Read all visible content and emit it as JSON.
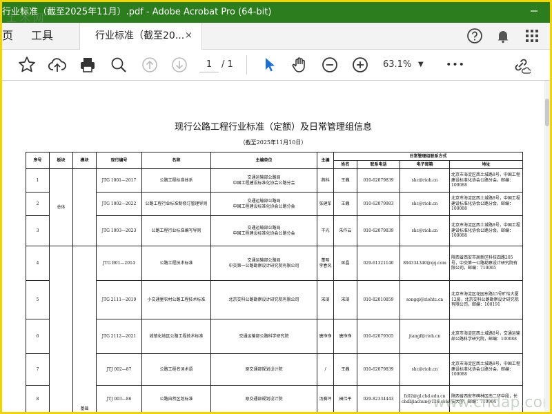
{
  "window": {
    "title": "行业标准（截至2025年11月）.pdf - Adobe Acrobat Pro (64-bit)",
    "minimize_icon": "minimize-icon",
    "colors": {
      "titlebar": "#2b7d1e",
      "frame": "#f0d400"
    }
  },
  "tabs": {
    "home_label": "页",
    "tools_label": "工具",
    "doc_label": "行业标准（截至20...",
    "close_label": "×"
  },
  "toolbar": {
    "icons": [
      "star-icon",
      "upload-icon",
      "print-icon",
      "search-zoom-icon",
      "page-up-icon",
      "page-down-icon",
      "select-arrow-icon",
      "hand-icon",
      "zoom-out-icon",
      "zoom-in-icon",
      "more-icon",
      "link-cloud-icon"
    ],
    "page_current": "1",
    "page_total": "/ 1",
    "zoom": "63.1%",
    "more": "•••"
  },
  "document": {
    "title": "现行公路工程行业标准（定额）及日常管理组信息",
    "subtitle": "（截至2025年11月10日）",
    "headers": {
      "no": "序号",
      "section": "板块",
      "module": "模块",
      "code": "现行编号",
      "name": "名称",
      "editor": "主编单位",
      "chief": "主编",
      "contact_group": "日常管理组联系方式",
      "person": "姓名",
      "phone": "联系电话",
      "email": "电子邮箱",
      "address": "地址"
    },
    "section_general": "总体",
    "module_basic": "基础",
    "rows": [
      {
        "no": "1",
        "code": "JTG 1001—2017",
        "name": "公路工程标准体系",
        "editor": "交通运输部公路局\n中国工程建设标准化协会公路分会",
        "chief": "燕科",
        "person": "王巍",
        "phone": "010-62079839",
        "email": "shc@rioh.cn",
        "address": "北京市海淀区西土城路8号，中国工程建设标准化协会公路分会，邮编：100088"
      },
      {
        "no": "2",
        "code": "JTG 1002—2022",
        "name": "公路工程行业标准制修订管理导则",
        "editor": "交通运输部公路局\n中国工程建设标准化协会公路分会",
        "chief": "张建军",
        "person": "王巍",
        "phone": "010-62079983",
        "email": "shc@rioh.cn",
        "address": "北京市海淀区西土城路8号，中国工程建设标准化协会公路分会，邮编：100088"
      },
      {
        "no": "3",
        "code": "JTG 1003—2023",
        "name": "公路工程行业标准编写导则",
        "editor": "交通运输部公路局\n中国工程建设标准化协会公路分会",
        "chief": "干光",
        "person": "朱作云",
        "phone": "010-62079839",
        "email": "shc@rioh.cn",
        "address": "北京市海淀区西土城路8号，中国工程建设标准化协会公路分会，邮编：100088"
      },
      {
        "no": "4",
        "code": "JTG B01—2014",
        "name": "公路工程技术标准",
        "editor": "交通运输部公路局\n中交第一公路勘察设计研究院有限公司",
        "chief": "董明\n李春风",
        "person": "匡晶",
        "phone": "029-61321140",
        "email": "894334340@qq.com",
        "address": "陕西省西安市高新区科技四路205号，中交第一公路勘察设计研究院有限公司，邮编：710065"
      },
      {
        "no": "5",
        "code": "JTG 2111—2019",
        "name": "小交通量农村公路工程技术标准",
        "editor": "北京交科公路勘察设计研究院有限公司",
        "chief": "宋琦",
        "person": "宋琦",
        "phone": "010-82010859",
        "email": "songqi@riohtc.cn",
        "address": "北京市海淀区花园东路15号旷怡大厦12层，北京交科公路勘察设计研究院有限公司，邮编：100191"
      },
      {
        "no": "6",
        "code": "JTG 2112—2021",
        "name": "城镇化地区公路工程技术标准",
        "editor": "交通运输部公路科学研究院",
        "chief": "唐琤琤",
        "person": "唐琤琤",
        "phone": "010-62079505",
        "email": "jtangf@rioh.cn",
        "address": "北京市海淀区西土城路8号，交通运输部公路科学研究院，邮编：100088"
      },
      {
        "no": "7",
        "code": "JTJ 002—87",
        "name": "公路工程名词术语",
        "editor": "原交通部规划设计院",
        "chief": "/",
        "person": "王巍",
        "phone": "010-62079839",
        "email": "shc@rioh.cn",
        "address": "北京市海淀区西土城路8号，中国工程建设标准化协会公路分会，邮编：100088"
      },
      {
        "no": "8",
        "code": "JTJ 003—86",
        "name": "公路自然区划标准",
        "editor": "原交通部规划设计院",
        "chief": "汤赛坪",
        "person": "田伟平",
        "phone": "029-82334443",
        "email": "fz02@gl.chd.edu.cn\nchdlijiachun@126.com",
        "address": "陕西省西安市碑林区南二环中段，长安大学，邮编：710064"
      }
    ]
  },
  "watermarks": {
    "top_left": "土 木 网",
    "bottom_right": "www.cndap.com"
  }
}
